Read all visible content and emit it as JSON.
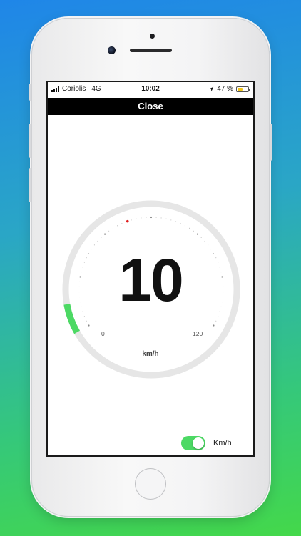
{
  "status_bar": {
    "carrier": "Coriolis",
    "network": "4G",
    "time": "10:02",
    "battery": "47 %",
    "battery_level": 0.47,
    "location_icon": "location-arrow-icon"
  },
  "header": {
    "close_label": "Close"
  },
  "speedometer": {
    "speed": "10",
    "speed_value": 10,
    "unit": "km/h",
    "min_label": "0",
    "max_label": "120",
    "min": 0,
    "max": 120,
    "track_color": "#e6e6e6",
    "progress_color": "#4cd964",
    "marker_color": "#e02020"
  },
  "unit_toggle": {
    "label": "Km/h",
    "on": true,
    "color": "#4cd964"
  }
}
